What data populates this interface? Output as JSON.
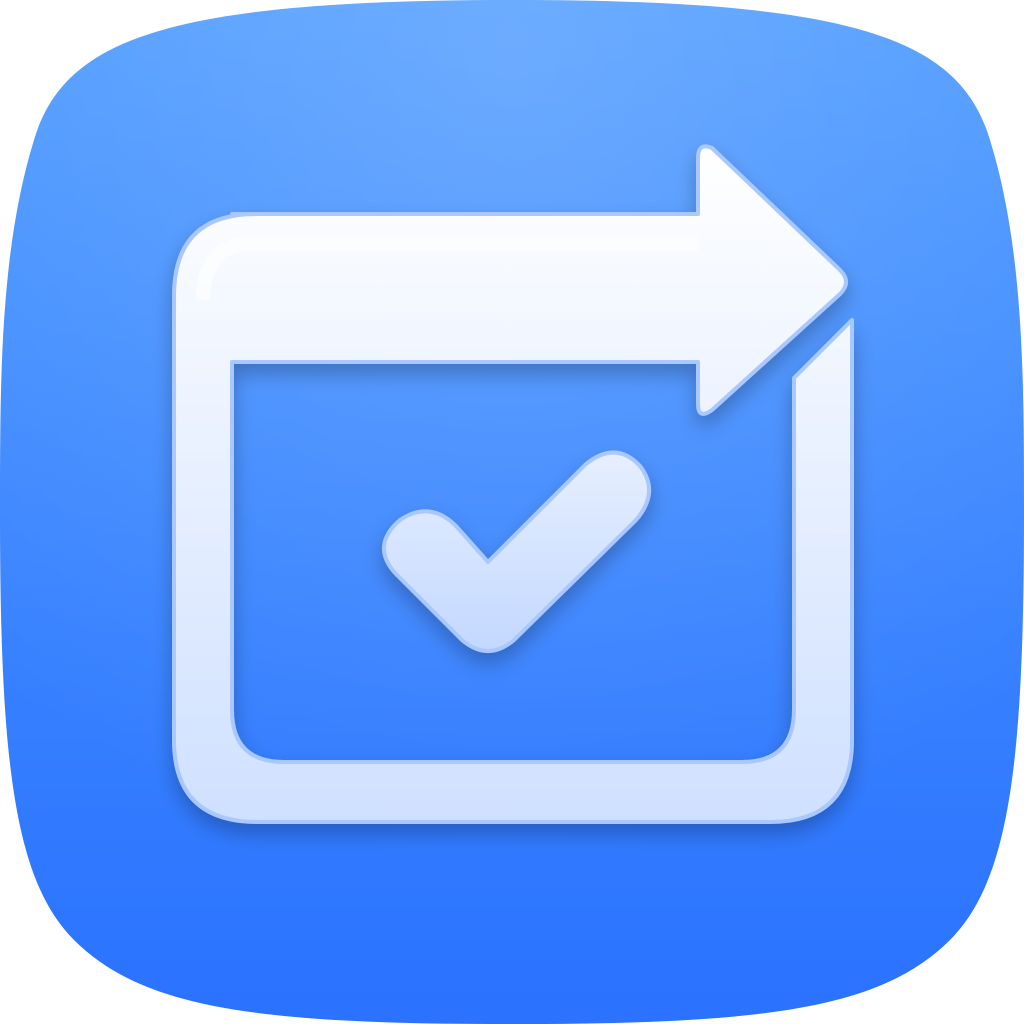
{
  "app_icon": {
    "icon_name": "calendar-task-forward-icon",
    "glyphs": [
      "rounded-frame",
      "forward-arrow",
      "checkmark"
    ],
    "colors": {
      "background_top": "#4d9bff",
      "background_bottom": "#2a72ff",
      "glyph_light": "#ffffff",
      "glyph_tint": "#cfe0ff",
      "glyph_edge": "#a9c8ff"
    }
  }
}
